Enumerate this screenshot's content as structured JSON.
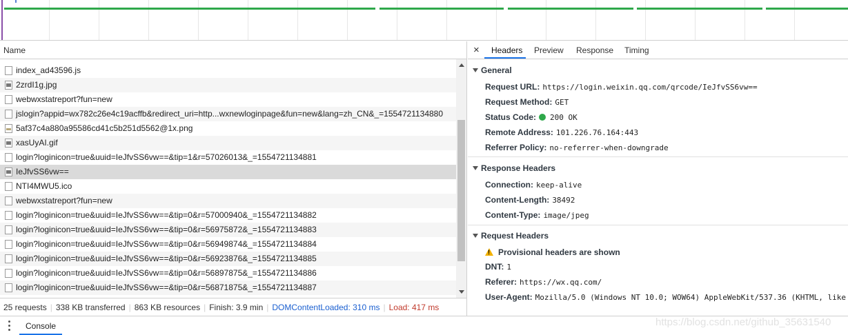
{
  "overview": {
    "bar_color": "#2ea84a",
    "cursor_color": "#8a4fa8"
  },
  "request_list": {
    "column_header": "Name",
    "rows": [
      {
        "name": "index_ad43596.js",
        "icon": "file-icon"
      },
      {
        "name": "2zrdI1g.jpg",
        "icon": "image-file-icon"
      },
      {
        "name": "webwxstatreport?fun=new",
        "icon": "file-icon"
      },
      {
        "name": "jslogin?appid=wx782c26e4c19acffb&redirect_uri=http...wxnewloginpage&fun=new&lang=zh_CN&_=1554721134880",
        "icon": "file-icon"
      },
      {
        "name": "5af37c4a880a95586cd41c5b251d5562@1x.png",
        "icon": "png-file-icon"
      },
      {
        "name": "xasUyAI.gif",
        "icon": "image-file-icon"
      },
      {
        "name": "login?loginicon=true&uuid=IeJfvSS6vw==&tip=1&r=57026013&_=1554721134881",
        "icon": "file-icon"
      },
      {
        "name": "IeJfvSS6vw==",
        "icon": "image-file-icon",
        "selected": true
      },
      {
        "name": "NTI4MWU5.ico",
        "icon": "file-icon"
      },
      {
        "name": "webwxstatreport?fun=new",
        "icon": "file-icon"
      },
      {
        "name": "login?loginicon=true&uuid=IeJfvSS6vw==&tip=0&r=57000940&_=1554721134882",
        "icon": "file-icon"
      },
      {
        "name": "login?loginicon=true&uuid=IeJfvSS6vw==&tip=0&r=56975872&_=1554721134883",
        "icon": "file-icon"
      },
      {
        "name": "login?loginicon=true&uuid=IeJfvSS6vw==&tip=0&r=56949874&_=1554721134884",
        "icon": "file-icon"
      },
      {
        "name": "login?loginicon=true&uuid=IeJfvSS6vw==&tip=0&r=56923876&_=1554721134885",
        "icon": "file-icon"
      },
      {
        "name": "login?loginicon=true&uuid=IeJfvSS6vw==&tip=0&r=56897875&_=1554721134886",
        "icon": "file-icon"
      },
      {
        "name": "login?loginicon=true&uuid=IeJfvSS6vw==&tip=0&r=56871875&_=1554721134887",
        "icon": "file-icon"
      }
    ]
  },
  "status_bar": {
    "requests": "25 requests",
    "transferred": "338 KB transferred",
    "resources": "863 KB resources",
    "finish": "Finish: 3.9 min",
    "dom_content_loaded": "DOMContentLoaded: 310 ms",
    "load": "Load: 417 ms",
    "dcl_color": "#1a5fd0",
    "load_color": "#c0392b"
  },
  "details": {
    "tabs": [
      "Headers",
      "Preview",
      "Response",
      "Timing"
    ],
    "active_tab": "Headers",
    "general": {
      "title": "General",
      "request_url_label": "Request URL:",
      "request_url": "https://login.weixin.qq.com/qrcode/IeJfvSS6vw==",
      "request_method_label": "Request Method:",
      "request_method": "GET",
      "status_code_label": "Status Code:",
      "status_code": "200 OK",
      "status_color": "#2ea84a",
      "remote_address_label": "Remote Address:",
      "remote_address": "101.226.76.164:443",
      "referrer_policy_label": "Referrer Policy:",
      "referrer_policy": "no-referrer-when-downgrade"
    },
    "response_headers": {
      "title": "Response Headers",
      "connection_label": "Connection:",
      "connection": "keep-alive",
      "content_length_label": "Content-Length:",
      "content_length": "38492",
      "content_type_label": "Content-Type:",
      "content_type": "image/jpeg"
    },
    "request_headers": {
      "title": "Request Headers",
      "warning": "Provisional headers are shown",
      "dnt_label": "DNT:",
      "dnt": "1",
      "referer_label": "Referer:",
      "referer": "https://wx.qq.com/",
      "user_agent_label": "User-Agent:",
      "user_agent": "Mozilla/5.0 (Windows NT 10.0; WOW64) AppleWebKit/537.36 (KHTML, like"
    }
  },
  "drawer": {
    "console_tab": "Console"
  },
  "watermark": "https://blog.csdn.net/github_35631540"
}
